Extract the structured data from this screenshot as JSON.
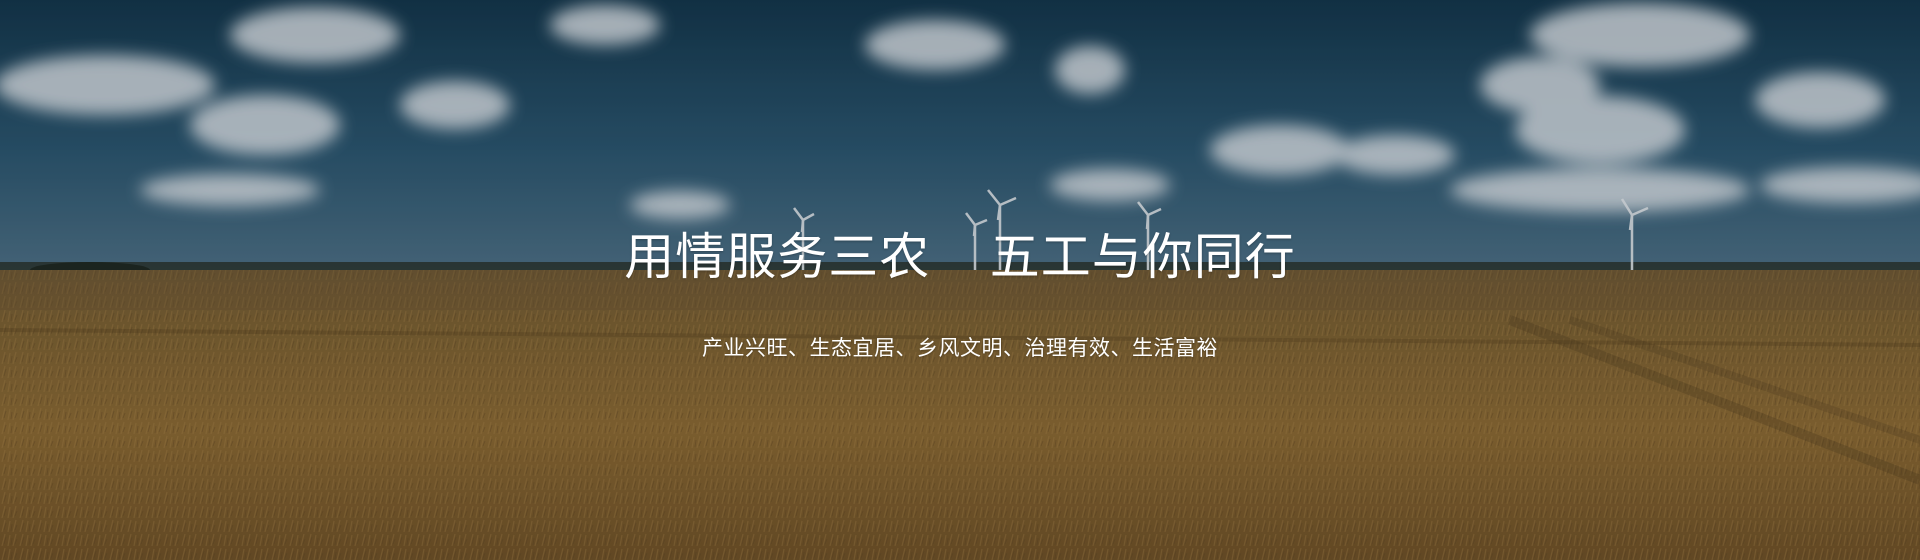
{
  "banner": {
    "headline": "用情服务三农    五工与你同行",
    "subline": "产业兴旺、生态宜居、乡风文明、治理有效、生活富裕",
    "background_scene": "wheat-field-with-wind-turbines-under-cloudy-sky"
  },
  "colors": {
    "sky_top": "#17374d",
    "sky_horizon": "#3f6680",
    "field_near": "#8a6a34",
    "field_far": "#6f5a35",
    "text": "#ffffff"
  }
}
